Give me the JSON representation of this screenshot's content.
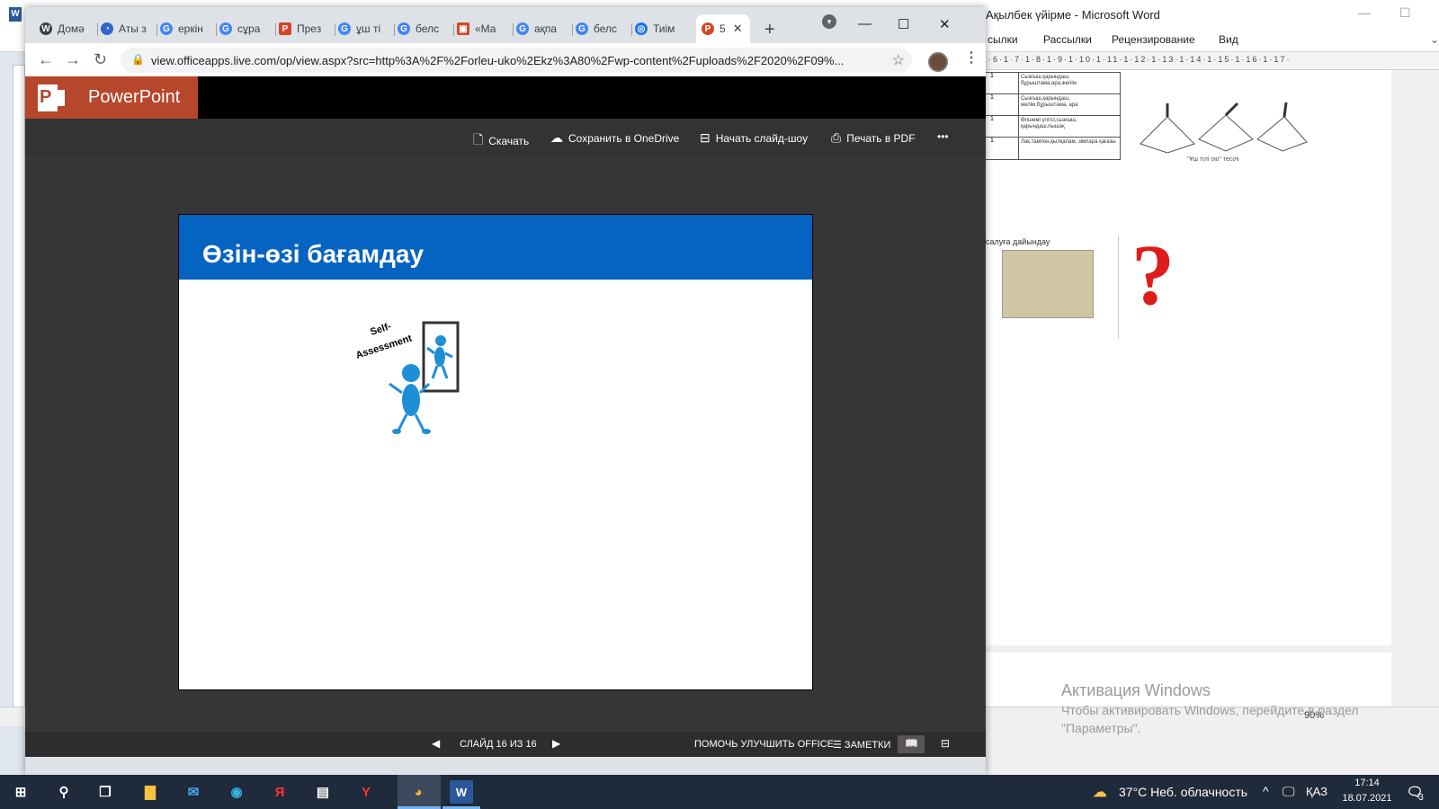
{
  "word": {
    "title": "Ақылбек үйірме - Microsoft Word",
    "ribbon_tabs": [
      "сылки",
      "Рассылки",
      "Рецензирование",
      "Вид"
    ],
    "ruler": "5·1·6·1·7·1·8·1·9·1·10·1·11·1·12·1·13·1·14·1·15·1·16·1·17·",
    "table_rows": [
      "Сызғыш,қарындаш, бұрыштама,ара,желім",
      "Сызғыш,қарындаш, желім,бұрыштама, ара",
      "Өлшемі үлгісі,сызғыш, қарындаш,пышақ",
      "Лак,тампон,қылқалам, зімпара қағазы"
    ],
    "figure_caption": "\"Ұш тілі ою\" тесілі",
    "image_caption": "салуға дайындау",
    "zoom": "90%",
    "activation_title": "Активация Windows",
    "activation_line1": "Чтобы активировать Windows, перейдите в раздел",
    "activation_line2": "\"Параметры\"."
  },
  "chrome": {
    "tabs": [
      {
        "label": "Домә",
        "icon": "W",
        "color": "#3c4043"
      },
      {
        "label": "Аты з",
        "icon": "◔",
        "color": "#3366cc"
      },
      {
        "label": "еркін",
        "icon": "G",
        "color": "#4285f4"
      },
      {
        "label": "сұра",
        "icon": "G",
        "color": "#4285f4"
      },
      {
        "label": "През",
        "icon": "P",
        "color": "#d24726"
      },
      {
        "label": "ұш ті",
        "icon": "G",
        "color": "#4285f4"
      },
      {
        "label": "белс",
        "icon": "G",
        "color": "#4285f4"
      },
      {
        "label": "«Ма",
        "icon": "▣",
        "color": "#d24726"
      },
      {
        "label": "ақпа",
        "icon": "G",
        "color": "#4285f4"
      },
      {
        "label": "белс",
        "icon": "G",
        "color": "#4285f4"
      },
      {
        "label": "Тиім",
        "icon": "◎",
        "color": "#1a73e8"
      }
    ],
    "active_tab": {
      "label": "5",
      "icon": "P",
      "color": "#d24726"
    },
    "url": "view.officeapps.live.com/op/view.aspx?src=http%3A%2F%2Forleu-uko%2Ekz%3A80%2Fwp-content%2Fuploads%2F2020%2F09%..."
  },
  "ppt": {
    "app_name": "PowerPoint",
    "commands": {
      "download": "Скачать",
      "save_onedrive": "Сохранить в OneDrive",
      "slideshow": "Начать слайд-шоу",
      "print_pdf": "Печать в PDF",
      "more": "•••"
    },
    "slide": {
      "title": "Өзін-өзі бағамдау",
      "clipart_text_1": "Self-",
      "clipart_text_2": "Assessment"
    },
    "status": {
      "slide_counter": "СЛАЙД 16 ИЗ 16",
      "help_improve": "ПОМОЧЬ УЛУЧШИТЬ OFFICE",
      "notes": "ЗАМЕТКИ"
    }
  },
  "taskbar": {
    "weather": "37°C  Неб. облачность",
    "language": "ҚАЗ",
    "time": "17:14",
    "date": "18.07.2021",
    "notifications": "3"
  },
  "colors": {
    "slide_title_bar": "#0563c1",
    "ppt_brand": "#b7472a",
    "clipart_figure": "#1e8fd6"
  }
}
